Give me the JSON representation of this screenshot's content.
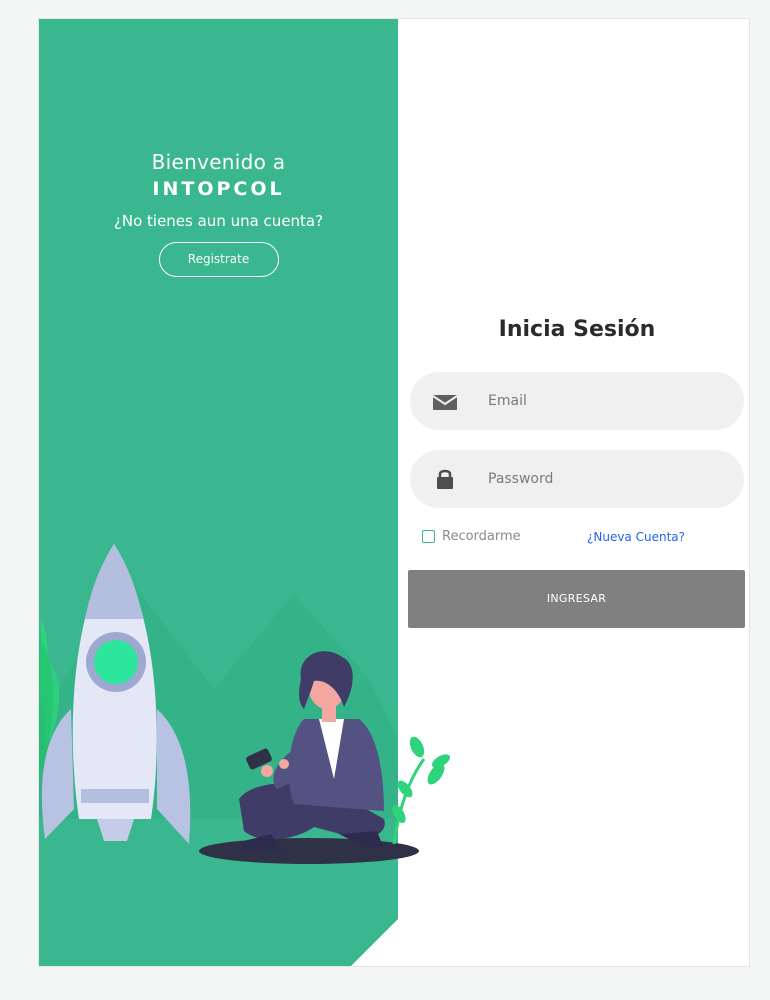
{
  "welcome": {
    "line1": "Bienvenido a",
    "brand": "INTOPCOL",
    "question": "¿No tienes aun una cuenta?",
    "register_label": "Registrate"
  },
  "login": {
    "title": "Inicia Sesión",
    "email_placeholder": "Email",
    "password_placeholder": "Password",
    "remember_label": "Recordarme",
    "new_account_label": "¿Nueva Cuenta?",
    "submit_label": "INGRESAR"
  },
  "icons": {
    "email": "envelope-icon",
    "password": "lock-icon",
    "illustration": "rocket-and-person-illustration"
  },
  "colors": {
    "brand_green": "#3bb78f",
    "button_gray": "#808080",
    "link_blue": "#2563eb",
    "input_bg": "#f0f0f0"
  }
}
